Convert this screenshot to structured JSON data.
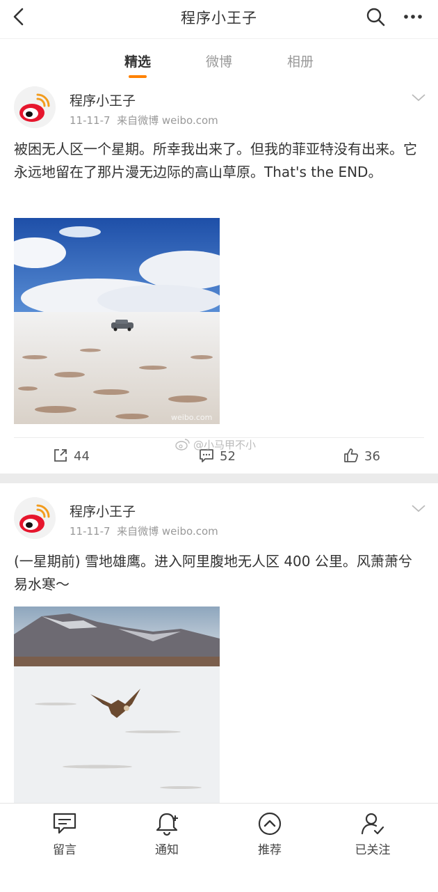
{
  "header": {
    "title": "程序小王子",
    "back_icon": "chevron-left-icon",
    "search_icon": "search-icon",
    "more_icon": "more-horizontal-icon"
  },
  "tabs": [
    {
      "label": "精选",
      "active": true
    },
    {
      "label": "微博",
      "active": false
    },
    {
      "label": "相册",
      "active": false
    }
  ],
  "accent_color": "#ff8200",
  "posts": [
    {
      "author": "程序小王子",
      "date": "11-11-7",
      "source": "来自微博 weibo.com",
      "text": "被困无人区一个星期。所幸我出来了。但我的菲亚特没有出来。它永远地留在了那片漫无边际的高山草原。That's the END。",
      "image_watermark": "weibo.com",
      "reposts": "44",
      "comments": "52",
      "likes": "36"
    },
    {
      "author": "程序小王子",
      "date": "11-11-7",
      "source": "来自微博 weibo.com",
      "text": "(一星期前) 雪地雄鹰。进入阿里腹地无人区 400 公里。风萧萧兮易水寒～"
    }
  ],
  "overlay_watermark": "@小马甲不小",
  "bottom_bar": [
    {
      "label": "留言",
      "icon": "message-icon"
    },
    {
      "label": "通知",
      "icon": "bell-plus-icon"
    },
    {
      "label": "推荐",
      "icon": "chevron-up-circle-icon"
    },
    {
      "label": "已关注",
      "icon": "user-check-icon"
    }
  ]
}
